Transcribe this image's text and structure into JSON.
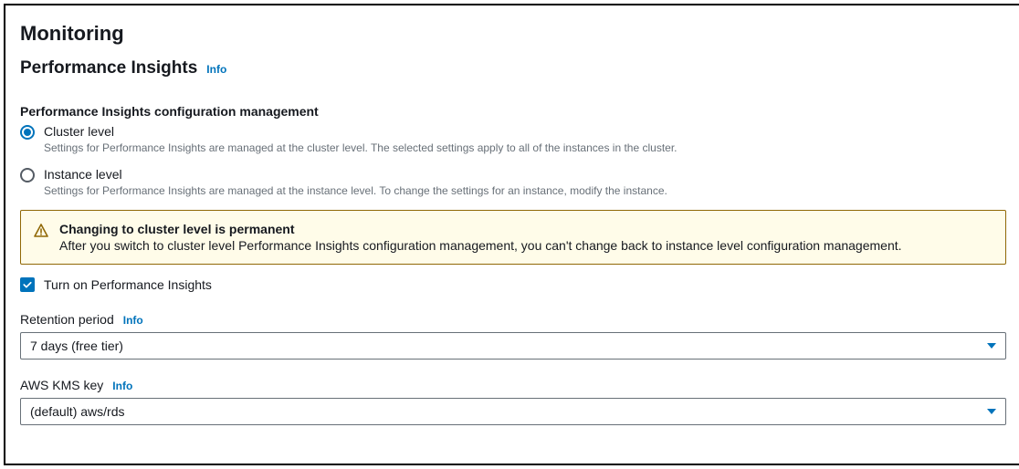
{
  "header": {
    "title": "Monitoring",
    "subtitle": "Performance Insights",
    "info": "Info"
  },
  "configMgmt": {
    "label": "Performance Insights configuration management",
    "options": [
      {
        "title": "Cluster level",
        "desc": "Settings for Performance Insights are managed at the cluster level. The selected settings apply to all of the instances in the cluster."
      },
      {
        "title": "Instance level",
        "desc": "Settings for Performance Insights are managed at the instance level. To change the settings for an instance, modify the instance."
      }
    ]
  },
  "warning": {
    "title": "Changing to cluster level is permanent",
    "text": "After you switch to cluster level Performance Insights configuration management, you can't change back to instance level configuration management."
  },
  "enable": {
    "label": "Turn on Performance Insights"
  },
  "retention": {
    "label": "Retention period",
    "info": "Info",
    "value": "7 days (free tier)"
  },
  "kms": {
    "label": "AWS KMS key",
    "info": "Info",
    "value": "(default) aws/rds"
  }
}
